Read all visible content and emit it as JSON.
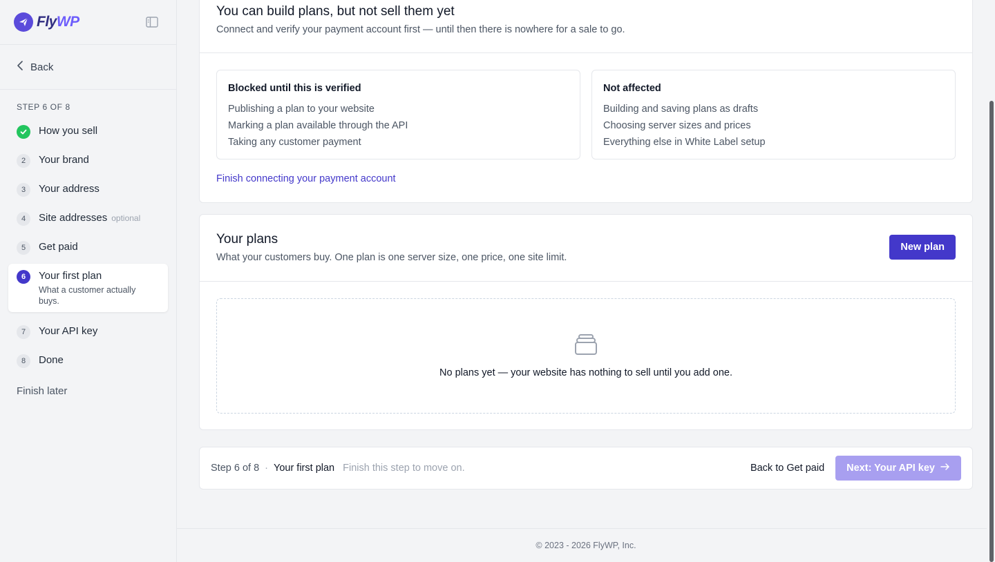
{
  "brand": {
    "name_a": "Fly",
    "name_b": "WP"
  },
  "sidebar": {
    "back_label": "Back",
    "step_heading": "STEP 6 OF 8",
    "steps": [
      {
        "num": "",
        "label": "How you sell"
      },
      {
        "num": "2",
        "label": "Your brand"
      },
      {
        "num": "3",
        "label": "Your address"
      },
      {
        "num": "4",
        "label": "Site addresses",
        "tag": "optional"
      },
      {
        "num": "5",
        "label": "Get paid"
      },
      {
        "num": "6",
        "label": "Your first plan",
        "sub": "What a customer actually buys."
      },
      {
        "num": "7",
        "label": "Your API key"
      },
      {
        "num": "8",
        "label": "Done"
      }
    ],
    "finish_later": "Finish later"
  },
  "warning": {
    "title": "You can build plans, but not sell them yet",
    "desc": "Connect and verify your payment account first — until then there is nowhere for a sale to go.",
    "blocked": {
      "title": "Blocked until this is verified",
      "items": [
        "Publishing a plan to your website",
        "Marking a plan available through the API",
        "Taking any customer payment"
      ]
    },
    "not_affected": {
      "title": "Not affected",
      "items": [
        "Building and saving plans as drafts",
        "Choosing server sizes and prices",
        "Everything else in White Label setup"
      ]
    },
    "link": "Finish connecting your payment account"
  },
  "plans": {
    "title": "Your plans",
    "desc": "What your customers buy. One plan is one server size, one price, one site limit.",
    "new_button": "New plan",
    "empty_text": "No plans yet — your website has nothing to sell until you add one."
  },
  "footer": {
    "step": "Step 6 of 8",
    "dot": "·",
    "title": "Your first plan",
    "hint": "Finish this step to move on.",
    "back": "Back to Get paid",
    "next": "Next: Your API key"
  },
  "copyright": "© 2023 - 2026 FlyWP, Inc.",
  "colors": {
    "accent": "#4338ca",
    "success": "#22c55e",
    "next_disabled": "#a89ff0"
  }
}
